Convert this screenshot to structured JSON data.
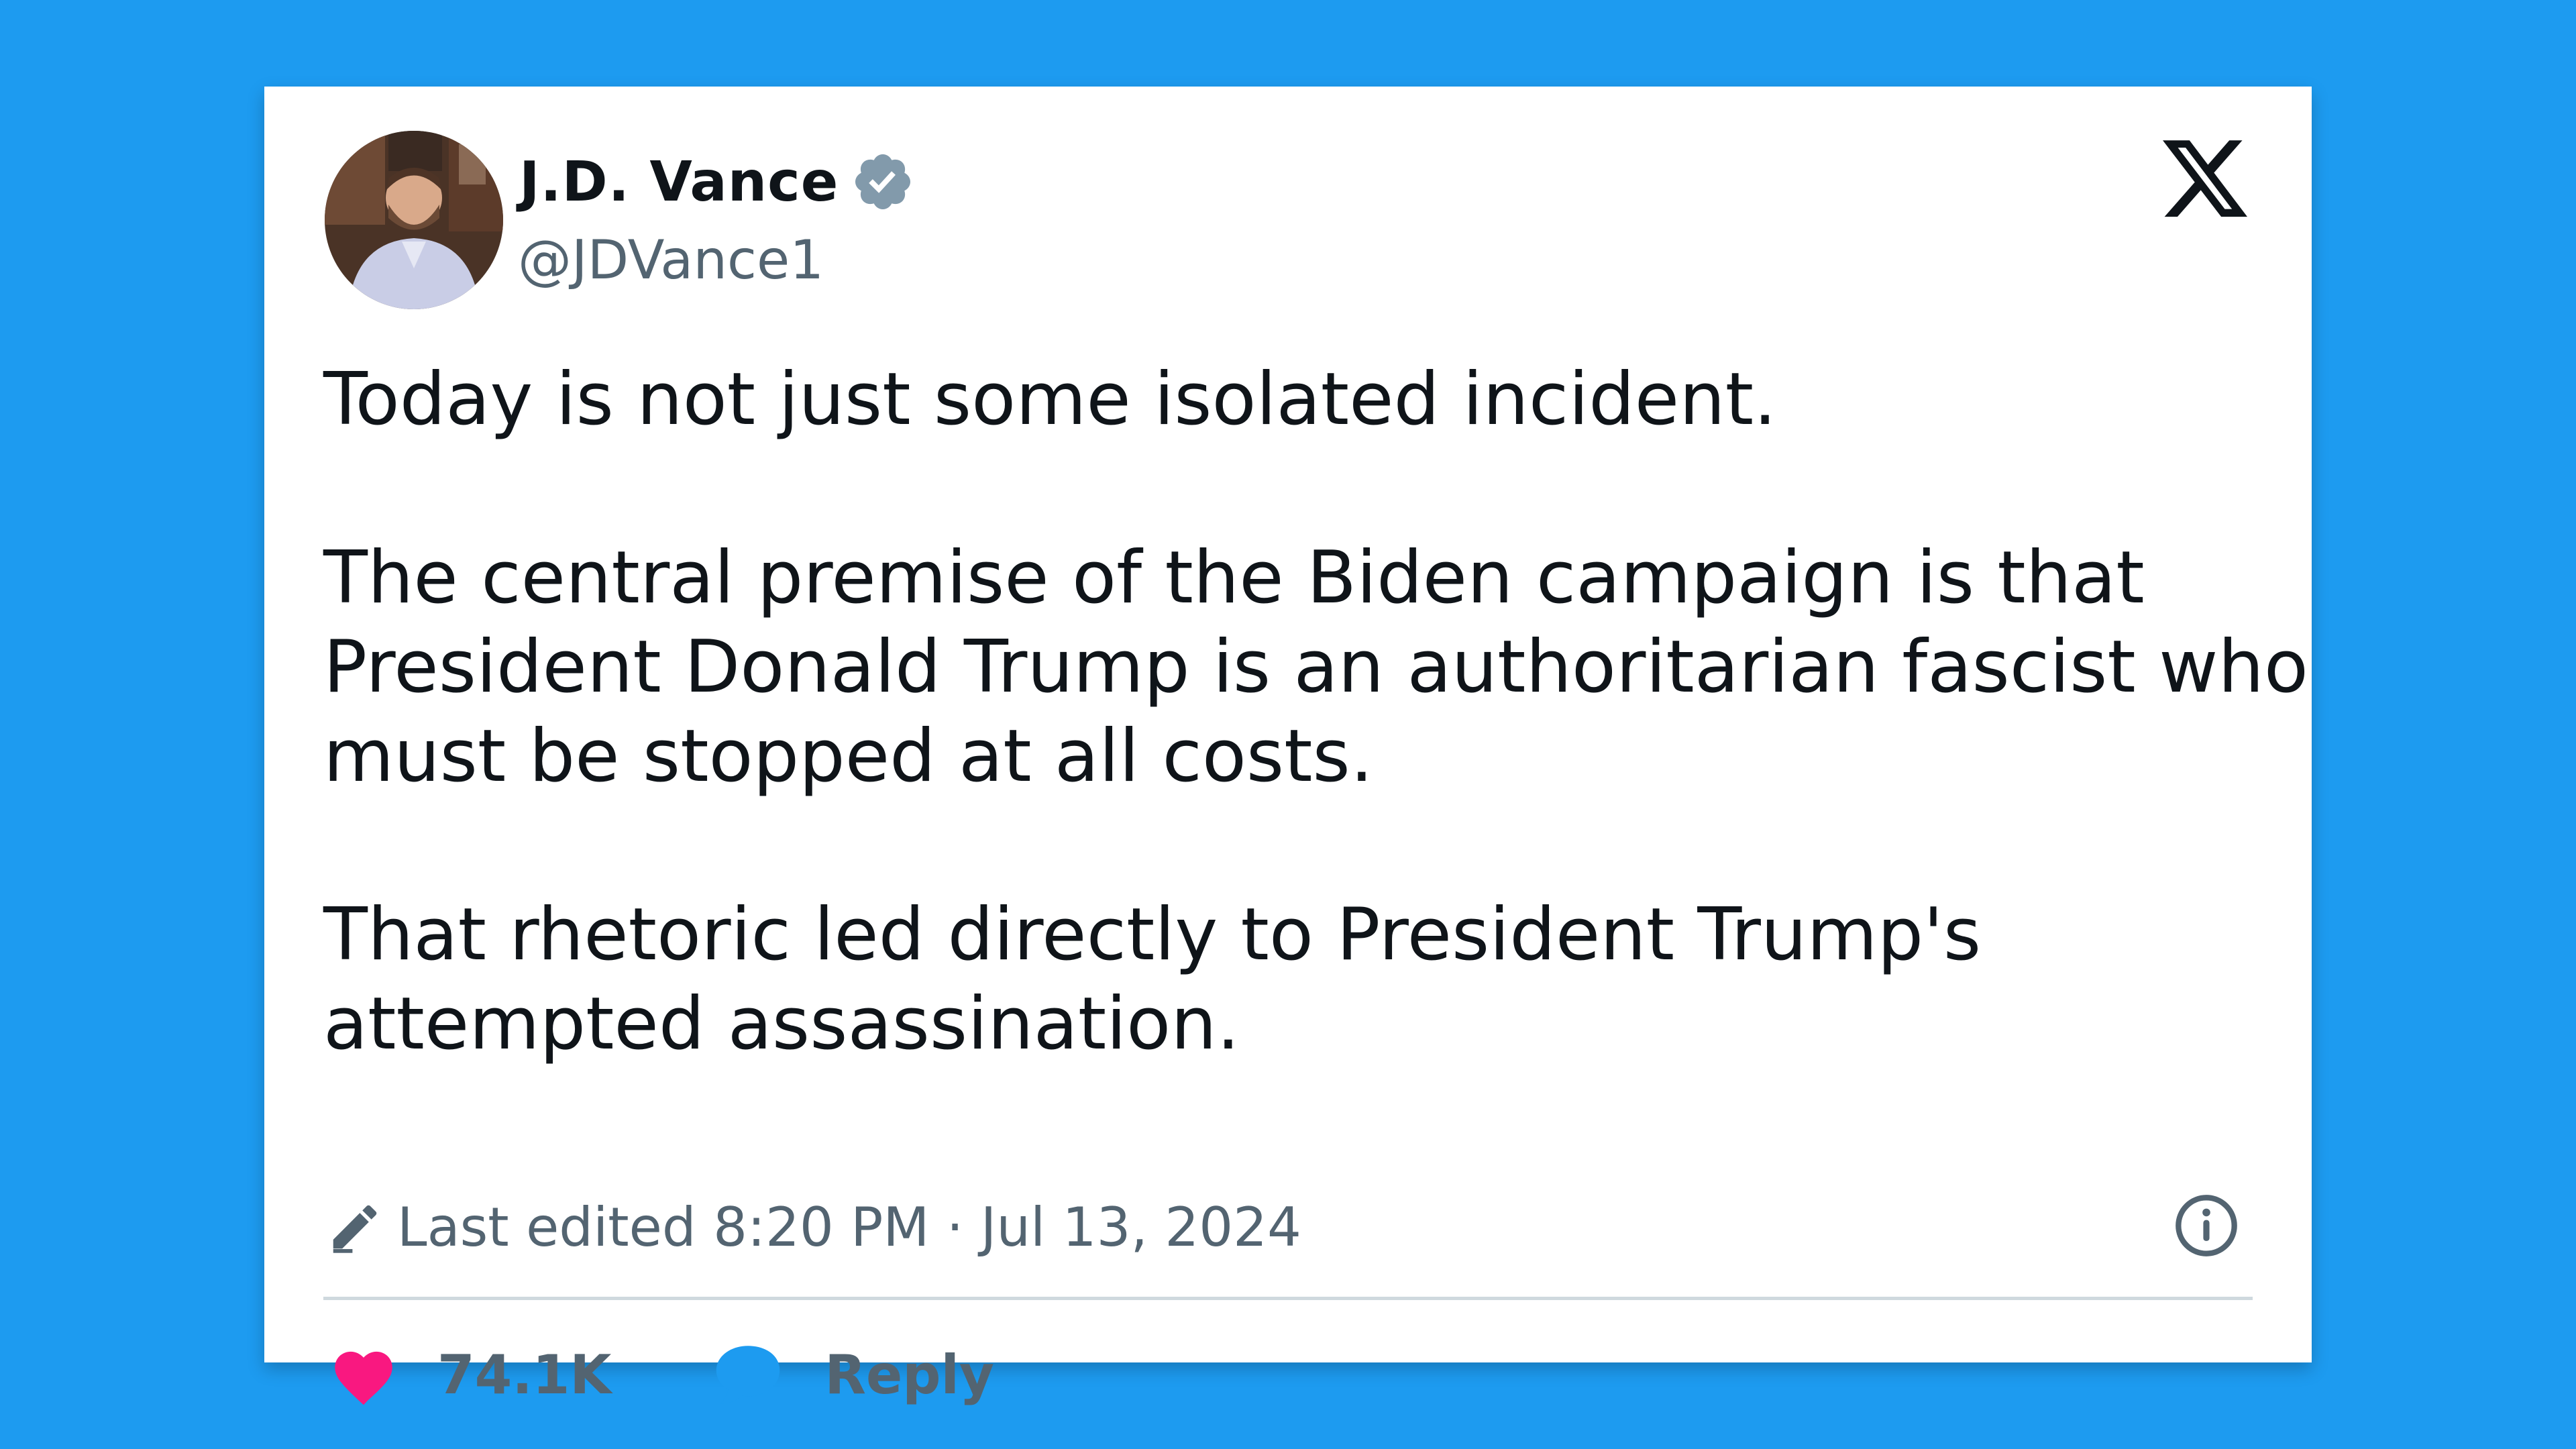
{
  "colors": {
    "background": "#1d9bf0",
    "card": "#ffffff",
    "text_primary": "#0f1419",
    "text_secondary": "#536471",
    "verified_badge": "#829aab",
    "heart": "#f91880",
    "reply_bubble": "#1d9bf0",
    "divider": "#cfd9de"
  },
  "author": {
    "name": "J.D. Vance",
    "handle": "@JDVance1",
    "avatar_icon": "profile-photo",
    "verified_icon": "verified-badge-icon"
  },
  "brand_icon": "x-logo-icon",
  "tweet": {
    "paragraphs": [
      [
        "Today is not just some isolated incident."
      ],
      [
        "The central premise of the Biden campaign is that",
        "President Donald Trump is an authoritarian fascist who",
        "must be stopped at all costs."
      ],
      [
        "That rhetoric led directly to President Trump's",
        "attempted assassination."
      ]
    ]
  },
  "meta": {
    "edited_icon": "pencil-icon",
    "edited_text": "Last edited 8:20 PM · Jul 13, 2024",
    "info_icon": "info-icon"
  },
  "actions": {
    "like_icon": "heart-icon",
    "like_count": "74.1K",
    "reply_icon": "speech-bubble-icon",
    "reply_label": "Reply"
  }
}
